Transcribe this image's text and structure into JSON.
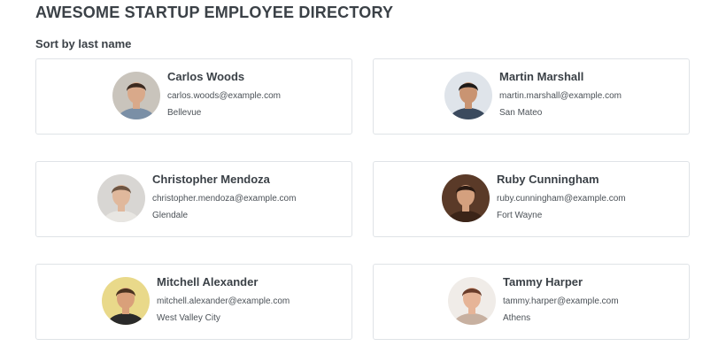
{
  "header": {
    "title": "AWESOME STARTUP EMPLOYEE DIRECTORY",
    "sort_label": "Sort by last name"
  },
  "employees": [
    {
      "name": "Carlos Woods",
      "email": "carlos.woods@example.com",
      "city": "Bellevue",
      "avatar_icon": "person-photo-icon",
      "avatar_colors": {
        "bg": "#c9c4bc",
        "skin": "#d9a98a",
        "hair": "#3b2a20",
        "shirt": "#7a8fa6"
      }
    },
    {
      "name": "Martin Marshall",
      "email": "martin.marshall@example.com",
      "city": "San Mateo",
      "avatar_icon": "person-photo-icon",
      "avatar_colors": {
        "bg": "#dfe4ea",
        "skin": "#c99472",
        "hair": "#1d1a18",
        "shirt": "#3b4a5e"
      }
    },
    {
      "name": "Christopher Mendoza",
      "email": "christopher.mendoza@example.com",
      "city": "Glendale",
      "avatar_icon": "person-photo-icon",
      "avatar_colors": {
        "bg": "#d8d6d3",
        "skin": "#e0b89c",
        "hair": "#6e5542",
        "shirt": "#e8e6e2"
      }
    },
    {
      "name": "Ruby Cunningham",
      "email": "ruby.cunningham@example.com",
      "city": "Fort Wayne",
      "avatar_icon": "person-photo-icon",
      "avatar_colors": {
        "bg": "#5a3a28",
        "skin": "#d4a07e",
        "hair": "#2a1a12",
        "shirt": "#3b2418"
      }
    },
    {
      "name": "Mitchell Alexander",
      "email": "mitchell.alexander@example.com",
      "city": "West Valley City",
      "avatar_icon": "person-photo-icon",
      "avatar_colors": {
        "bg": "#e9d98a",
        "skin": "#d9a07a",
        "hair": "#4a3320",
        "shirt": "#2a2a2a"
      }
    },
    {
      "name": "Tammy Harper",
      "email": "tammy.harper@example.com",
      "city": "Athens",
      "avatar_icon": "person-photo-icon",
      "avatar_colors": {
        "bg": "#f0ece8",
        "skin": "#e6b497",
        "hair": "#6a3c2a",
        "shirt": "#c7b0a0"
      }
    }
  ]
}
